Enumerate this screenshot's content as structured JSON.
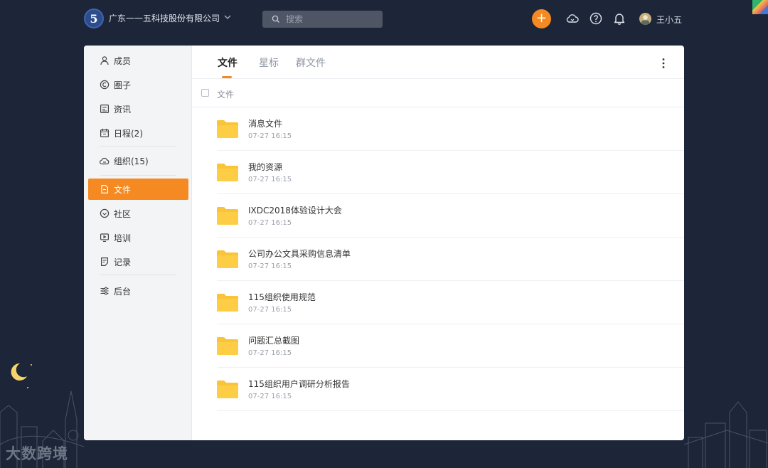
{
  "topbar": {
    "org_logo": "5",
    "org_name": "广东一一五科技股份有限公司",
    "search_placeholder": "搜索",
    "add_label": "+",
    "user_name": "王小五"
  },
  "sidebar": {
    "items": [
      {
        "label": "成员",
        "icon": "person-icon"
      },
      {
        "label": "圈子",
        "icon": "circle-c-icon"
      },
      {
        "label": "资讯",
        "icon": "news-icon"
      },
      {
        "label": "日程(2)",
        "icon": "calendar-icon"
      },
      {
        "label": "组织(15)",
        "icon": "cloud-org-icon"
      },
      {
        "label": "文件",
        "icon": "file-icon"
      },
      {
        "label": "社区",
        "icon": "community-icon"
      },
      {
        "label": "培训",
        "icon": "training-icon"
      },
      {
        "label": "记录",
        "icon": "record-icon"
      },
      {
        "label": "后台",
        "icon": "settings-icon"
      }
    ],
    "active": "文件"
  },
  "tabs": [
    {
      "label": "文件",
      "active": true
    },
    {
      "label": "星标",
      "active": false
    },
    {
      "label": "群文件",
      "active": false
    }
  ],
  "list": {
    "header": "文件",
    "files": [
      {
        "name": "消息文件",
        "time": "07-27 16:15"
      },
      {
        "name": "我的资源",
        "time": "07-27 16:15"
      },
      {
        "name": "IXDC2018体验设计大会",
        "time": "07-27 16:15"
      },
      {
        "name": "公司办公文具采购信息清单",
        "time": "07-27 16:15"
      },
      {
        "name": "115组织使用规范",
        "time": "07-27 16:15"
      },
      {
        "name": "问题汇总截图",
        "time": "07-27 16:15"
      },
      {
        "name": "115组织用户调研分析报告",
        "time": "07-27 16:15"
      }
    ]
  },
  "watermark": "大数跨境",
  "colors": {
    "background": "#1d2538",
    "accent": "#f58a23",
    "folder": "#f9c33a"
  }
}
